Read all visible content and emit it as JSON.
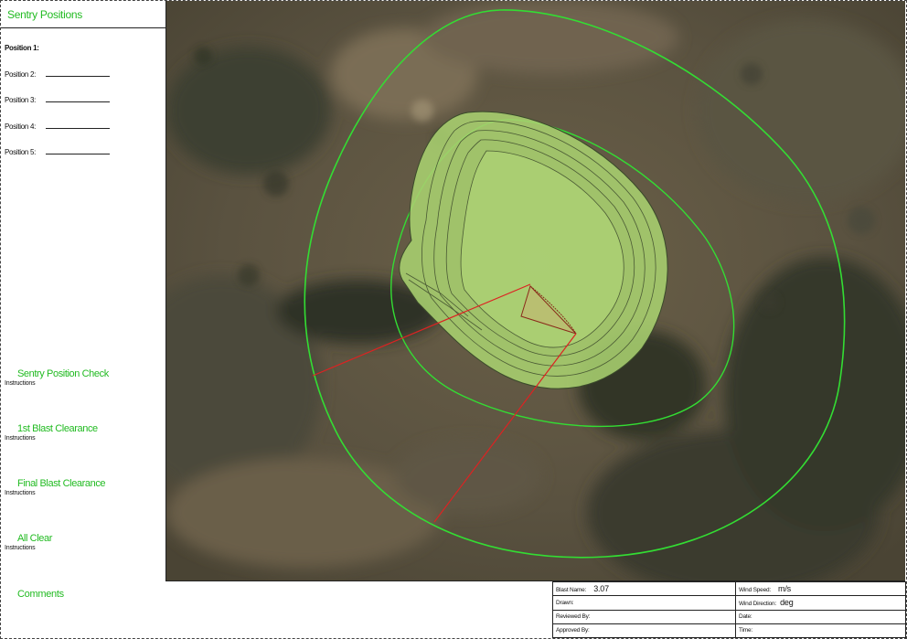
{
  "left_panel": {
    "title": "Sentry Positions",
    "positions": [
      {
        "label": "Position 1:"
      },
      {
        "label": "Position 2:"
      },
      {
        "label": "Position 3:"
      },
      {
        "label": "Position 4:"
      },
      {
        "label": "Position 5:"
      }
    ],
    "sections": [
      {
        "title": "Sentry Position Check",
        "instructions": "Instructions"
      },
      {
        "title": "1st Blast Clearance",
        "instructions": "Instructions"
      },
      {
        "title": "Final Blast Clearance",
        "instructions": "Instructions"
      },
      {
        "title": "All Clear",
        "instructions": "Instructions"
      }
    ]
  },
  "bottom": {
    "comments_title": "Comments",
    "info": {
      "blast_name_label": "Blast Name:",
      "blast_name_value": "3.07",
      "drawn_label": "Drawn:",
      "reviewed_label": "Reviewed By:",
      "approved_label": "Approved By:",
      "wind_speed_label": "Wind Speed:",
      "wind_speed_unit": "m/s",
      "wind_direction_label": "Wind Direction:",
      "wind_direction_unit": "deg",
      "date_label": "Date:",
      "time_label": "Time:"
    }
  },
  "colors": {
    "accent_green": "#22bb22",
    "clearance_ring": "#33dd33",
    "sentry_line": "#dd2222",
    "pit_fill": "#a8d070"
  }
}
